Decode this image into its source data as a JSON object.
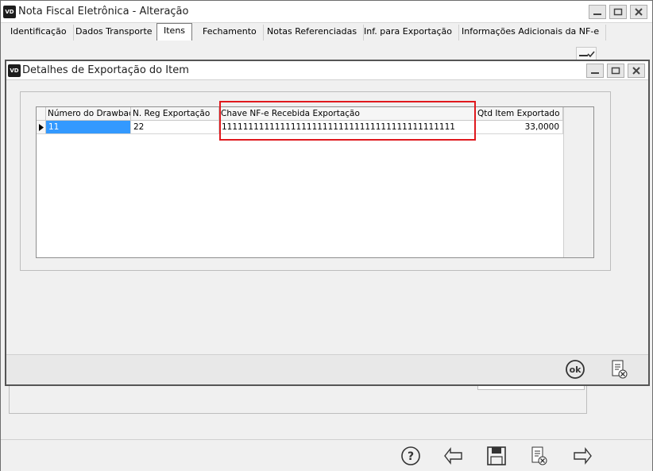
{
  "window": {
    "app_badge": "VD",
    "title": "Nota Fiscal Eletrônica - Alteração"
  },
  "tabs": [
    {
      "label": "Identificação",
      "active": false
    },
    {
      "label": "Dados Transporte",
      "active": false
    },
    {
      "label": "Itens",
      "active": true
    },
    {
      "label": "Fechamento",
      "active": false
    },
    {
      "label": "Notas Referenciadas",
      "active": false
    },
    {
      "label": "Inf. para Exportação",
      "active": false
    },
    {
      "label": "Informações Adicionais da NF-e",
      "active": false
    }
  ],
  "dialog": {
    "app_badge": "VD",
    "title": "Detalhes de Exportação do Item",
    "grid": {
      "columns": [
        "Número do Drawback",
        "N. Reg Exportação",
        "Chave NF-e Recebida Exportação",
        "Qtd Item Exportado"
      ],
      "rows": [
        {
          "drawback": "11",
          "reg_exportacao": "22",
          "chave_nfe": "11111111111111111111111111111111111111111111",
          "qtd_item": "33,0000"
        }
      ]
    },
    "footer_icons": [
      "ok-icon",
      "cancel-doc-icon"
    ]
  },
  "colors": {
    "highlight": "#e0191e",
    "selection": "#3399ff"
  },
  "toolbar_icons": [
    "help-icon",
    "arrow-left-icon",
    "save-icon",
    "cancel-doc-icon",
    "arrow-right-icon"
  ]
}
